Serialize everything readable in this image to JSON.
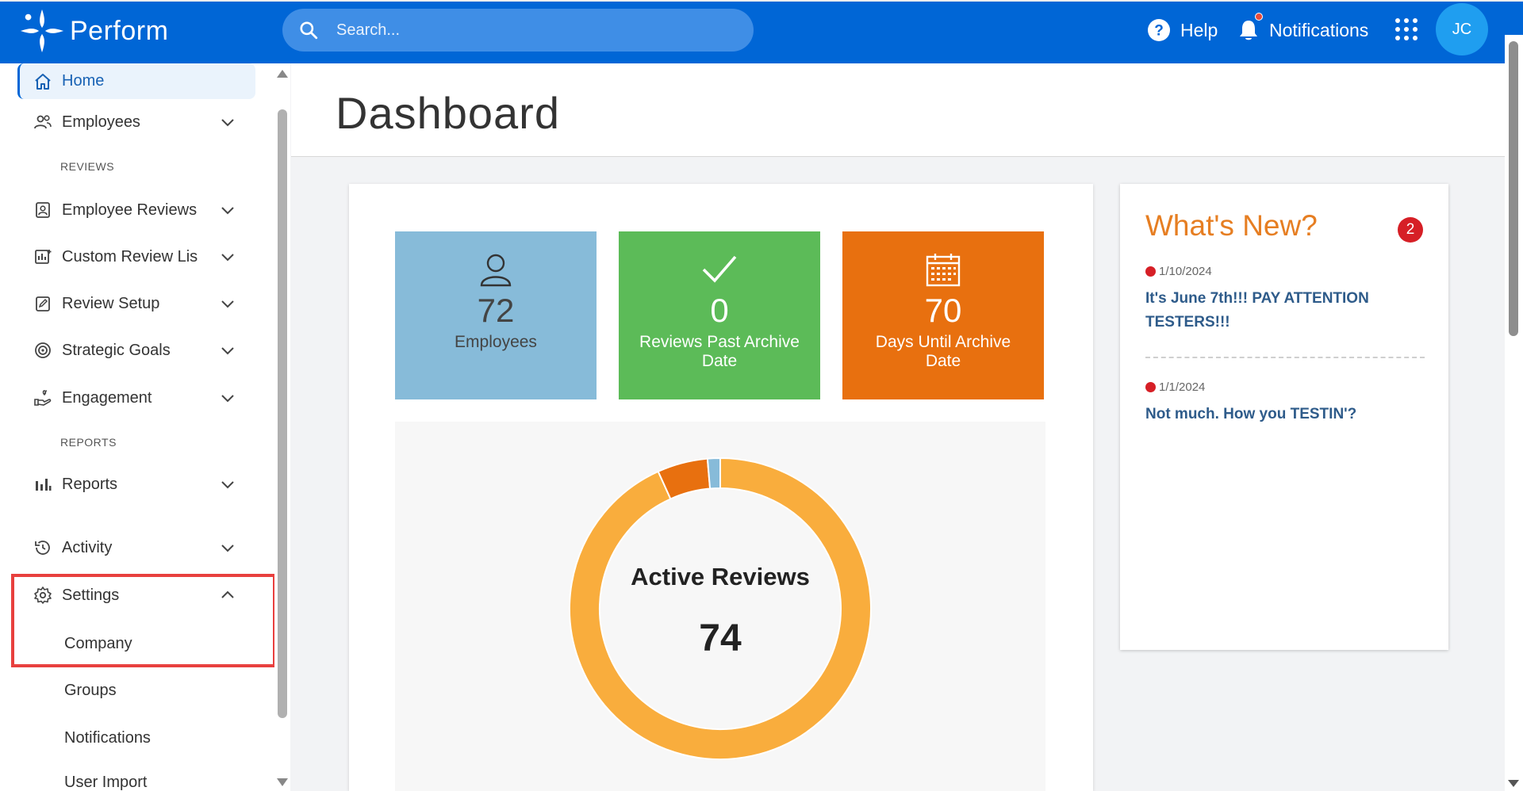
{
  "app": {
    "name": "Perform"
  },
  "header": {
    "search_placeholder": "Search...",
    "help_label": "Help",
    "notifications_label": "Notifications",
    "avatar_initials": "JC"
  },
  "sidebar": {
    "home": "Home",
    "employees": "Employees",
    "reviews_section": "REVIEWS",
    "employee_reviews": "Employee Reviews",
    "custom_review_lists": "Custom Review Lis",
    "review_setup": "Review Setup",
    "strategic_goals": "Strategic Goals",
    "engagement": "Engagement",
    "reports_section": "REPORTS",
    "reports": "Reports",
    "activity": "Activity",
    "settings": "Settings",
    "settings_sub": [
      "Company",
      "Groups",
      "Notifications",
      "User Import"
    ]
  },
  "page": {
    "title": "Dashboard"
  },
  "tiles": [
    {
      "value": "72",
      "label": "Employees"
    },
    {
      "value": "0",
      "label": "Reviews Past Archive Date"
    },
    {
      "value": "70",
      "label": "Days Until Archive Date"
    }
  ],
  "chart_data": {
    "type": "pie",
    "title": "Active Reviews",
    "total": 74,
    "segments": [
      {
        "value": 69,
        "color": "#f9ad3d"
      },
      {
        "value": 4,
        "color": "#e8700f"
      },
      {
        "value": 1,
        "color": "#87bbd9"
      }
    ]
  },
  "whats_new": {
    "title": "What's New?",
    "count": "2",
    "items": [
      {
        "date": "1/10/2024",
        "headline": "It's June 7th!!! PAY ATTENTION TESTERS!!!"
      },
      {
        "date": "1/1/2024",
        "headline": "Not much. How you TESTIN'?"
      }
    ]
  },
  "colors": {
    "brand": "#0066d6",
    "tile_blue": "#87bbd9",
    "tile_green": "#5cbb58",
    "tile_orange": "#e8700f",
    "highlight": "#e8403e"
  }
}
